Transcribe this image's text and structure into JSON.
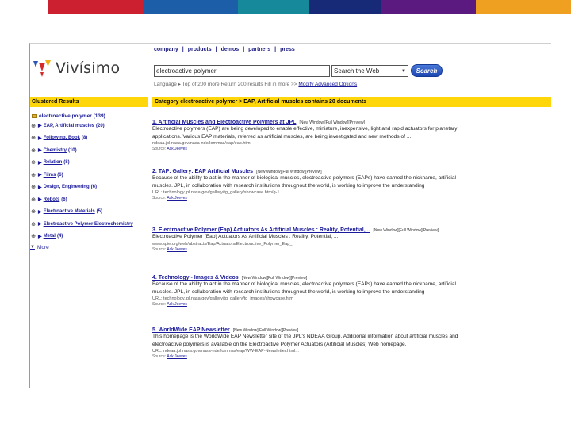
{
  "stripe_colors": [
    "#ffffff",
    "#cc2030",
    "#1c5ea8",
    "#168a9a",
    "#162a78",
    "#5a1a80",
    "#f0a020"
  ],
  "logo": {
    "text": "Vivísimo",
    "colors": [
      "#2a56b8",
      "#d42a2a",
      "#f0b018"
    ]
  },
  "topnav": {
    "items": [
      "company",
      "products",
      "demos",
      "partners",
      "press"
    ],
    "separator": "|"
  },
  "search": {
    "query": "electroactive polymer",
    "scope": "Search the Web",
    "button": "Search",
    "options_text": "Language ▸  Top of 200 more  Return 200 results  Fill in more >>",
    "advanced": "Modify Advanced Options"
  },
  "clusters": {
    "header": "Clustered Results",
    "root": "electroactive polymer (139)",
    "items": [
      {
        "exp": "⊕",
        "label": "EAP, Artificial muscles",
        "count": "(20)"
      },
      {
        "exp": "⊕",
        "label": "Following, Book",
        "count": "(8)"
      },
      {
        "exp": "⊕",
        "label": "Chemistry",
        "count": "(10)"
      },
      {
        "exp": "⊕",
        "label": "Relation",
        "count": "(8)"
      },
      {
        "exp": "⊕",
        "label": "Films",
        "count": "(6)"
      },
      {
        "exp": "⊕",
        "label": "Design, Engineering",
        "count": "(6)"
      },
      {
        "exp": "⊕",
        "label": "Robots",
        "count": "(6)"
      },
      {
        "exp": "⊕",
        "label": "Electroactive Materials",
        "count": "(5)"
      },
      {
        "exp": "⊕",
        "label": "Electroactive Polymer Electrochemistry",
        "count": ""
      },
      {
        "exp": "⊕",
        "label": "Metal",
        "count": "(4)"
      }
    ],
    "more": "More"
  },
  "results_header": "Category electroactive polymer > EAP, Artificial muscles contains 20 documents",
  "results": [
    {
      "title": "1. Artificial Muscles and Electroactive Polymers at JPL",
      "links": [
        "[New Window]",
        "[Full Window]",
        "[Preview]"
      ],
      "snippet": [
        "Electroactive polymers (EAP) are being developed to enable effective, miniature, inexpensive, light and rapid actuators for planetary",
        "applications. Various EAP materials, referred as artificial muscles, are being investigated and new methods of ..."
      ],
      "url": "ndeaa.jpl.nasa.gov/nasa-nde/lommas/eap/eap.htm",
      "source": "Source:",
      "source_link": "Ask Jeeves"
    },
    {
      "title": "2. TAP: Gallery: EAP Artificial Muscles",
      "links": [
        "[New Window]",
        "[Full Window]",
        "[Preview]"
      ],
      "snippet": [
        "Because of the ability to act in the manner of biological muscles, electroactive polymers (EAPs) have earned the nickname, artificial",
        "muscles. JPL, in collaboration with research institutions throughout the world, is working to improve the understanding"
      ],
      "url": "URL: technology.jpl.nasa.gov/gallery/tg_gallery/showcase.htm/g-1...",
      "source": "Source:",
      "source_link": "Ask Jeeves"
    },
    {
      "title": "3. Electroactive Polymer (Eap) Actuators As Artificial Muscles : Reality, Potential,...",
      "links": [
        "[New Window]",
        "[Full Window]",
        "[Preview]"
      ],
      "snippet": [
        "Electroactive Polymer (Eap) Actuators As Artificial Muscles : Reality, Potential, ..."
      ],
      "url": "www.spie.org/web/abstracts/Eap/Actuators/Electroactive_Polymer_Eap_",
      "source": "Source:",
      "source_link": "Ask Jeeves"
    },
    {
      "title": "4. Technology - Images & Videos",
      "links": [
        "[New Window]",
        "[Full Window]",
        "[Preview]"
      ],
      "snippet": [
        "Because of the ability to act in the manner of biological muscles, electroactive polymers (EAPs) have earned the nickname, artificial",
        "muscles. JPL, in collaboration with research institutions throughout the world, is working to improve the understanding"
      ],
      "url": "URL: technology.jpl.nasa.gov/gallery/tg_gallery/tg_images/showcase.htm",
      "source": "Source:",
      "source_link": "Ask Jeeves"
    },
    {
      "title": "5. WorldWide EAP Newsletter",
      "links": [
        "[New Window]",
        "[Full Window]",
        "[Preview]"
      ],
      "snippet": [
        "This homepage is the WorldWide EAP Newsletter site of the JPL's NDEAA Group. Additional information about artificial muscles and",
        "electroactive polymers is available on the Electroactive Polymer Actuators (Artificial Muscles) Web homepage."
      ],
      "url": "URL: ndeaa.jpl.nasa.gov/nasa-nde/lommas/eap/WW-EAP-Newsletter.html...",
      "source": "Source:",
      "source_link": "Ask Jeeves"
    }
  ]
}
